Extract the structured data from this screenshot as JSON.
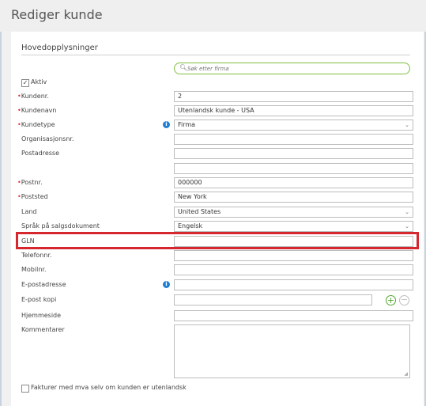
{
  "header": {
    "title": "Rediger kunde"
  },
  "section": {
    "title": "Hovedopplysninger"
  },
  "search": {
    "placeholder": "Søk etter firma"
  },
  "aktiv": {
    "label": "Aktiv",
    "checked_mark": "✓"
  },
  "required_marker": "•",
  "info_icon_glyph": "i",
  "fields": {
    "kundenr": {
      "label": "Kundenr.",
      "value": "2"
    },
    "kundenavn": {
      "label": "Kundenavn",
      "value": "Utenlandsk kunde - USA"
    },
    "kundetype": {
      "label": "Kundetype",
      "value": "Firma"
    },
    "organisasjonsnr": {
      "label": "Organisasjonsnr.",
      "value": ""
    },
    "postadresse": {
      "label": "Postadresse",
      "value1": "",
      "value2": ""
    },
    "postnr": {
      "label": "Postnr.",
      "value": "000000"
    },
    "poststed": {
      "label": "Poststed",
      "value": "New York"
    },
    "land": {
      "label": "Land",
      "value": "United States"
    },
    "sprak": {
      "label": "Språk på salgsdokument",
      "value": "Engelsk"
    },
    "gln": {
      "label": "GLN",
      "value": ""
    },
    "telefonnr": {
      "label": "Telefonnr.",
      "value": ""
    },
    "mobilnr": {
      "label": "Mobilnr.",
      "value": ""
    },
    "epostadresse": {
      "label": "E-postadresse",
      "value": ""
    },
    "epost_kopi": {
      "label": "E-post kopi",
      "value": ""
    },
    "hjemmeside": {
      "label": "Hjemmeside",
      "value": ""
    },
    "kommentarer": {
      "label": "Kommentarer",
      "value": ""
    }
  },
  "select_arrow": "⌄",
  "buttons": {
    "add": "+",
    "remove": "−"
  },
  "footer_checkbox": {
    "label": "Fakturer med mva selv om kunden er utenlandsk"
  },
  "colors": {
    "highlight": "#d6262e",
    "accent_green": "#7fbf3f",
    "info_blue": "#1f7fd6",
    "required_red": "#e03030"
  }
}
